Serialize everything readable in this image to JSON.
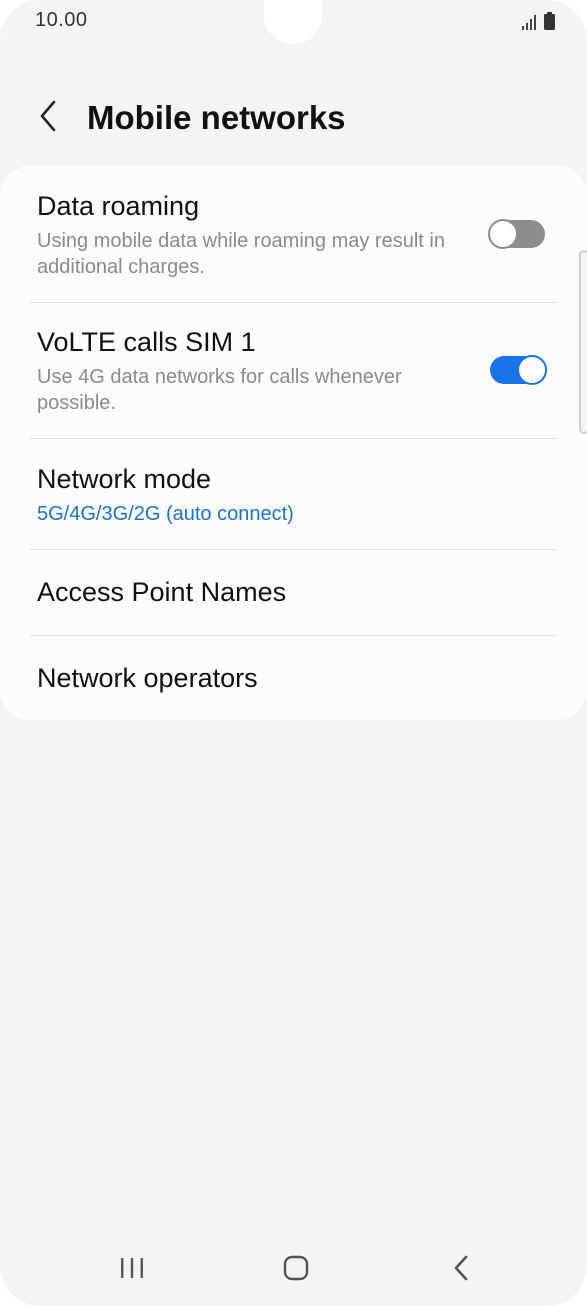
{
  "status_bar": {
    "time": "10.00"
  },
  "header": {
    "title": "Mobile networks"
  },
  "settings": {
    "data_roaming": {
      "title": "Data roaming",
      "subtitle": "Using mobile data while roaming may result in additional charges.",
      "enabled": false
    },
    "volte": {
      "title": "VoLTE calls SIM 1",
      "subtitle": "Use 4G data networks for calls whenever possible.",
      "enabled": true
    },
    "network_mode": {
      "title": "Network mode",
      "value": "5G/4G/3G/2G (auto connect)"
    },
    "access_point_names": {
      "title": "Access Point Names"
    },
    "network_operators": {
      "title": "Network operators"
    }
  },
  "colors": {
    "accent": "#1a73e8",
    "value_text": "#1a73c8",
    "toggle_off": "#8d8d8d",
    "background": "#f4f4f4",
    "card": "#fcfcfc"
  },
  "icons": {
    "back": "chevron-left-icon",
    "signal": "signal-icon",
    "battery": "battery-icon",
    "recents": "recents-icon",
    "home": "home-icon",
    "nav_back": "back-icon"
  }
}
